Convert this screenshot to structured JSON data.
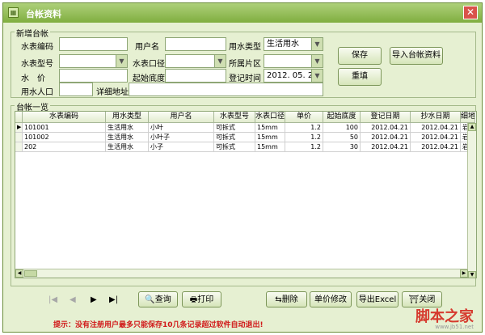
{
  "window": {
    "title": "台帐资料",
    "close_label": "✕"
  },
  "form": {
    "group_label": "新增台帐",
    "meter_no_label": "水表编码",
    "meter_no_value": "",
    "user_name_label": "用户名",
    "user_name_value": "",
    "water_type_label": "用水类型",
    "water_type_value": "生活用水",
    "meter_model_label": "水表型号",
    "meter_model_value": "",
    "caliber_label": "水表口径",
    "caliber_value": "",
    "area_label": "所属片区",
    "area_value": "",
    "price_label": "水　价",
    "price_value": "",
    "start_reading_label": "起始底度",
    "start_reading_value": "",
    "reg_time_label": "登记时间",
    "reg_time_value": "2012. 05. 22",
    "population_label": "用水人口",
    "population_value": "",
    "address_label": "详细地址",
    "address_value": "",
    "save_label": "保存",
    "import_label": "导入台帐资料",
    "clear_label": "重填"
  },
  "table": {
    "group_label": "台帐一览",
    "columns": [
      "水表编码",
      "用水类型",
      "用户名",
      "水表型号",
      "水表口径",
      "单价",
      "起始底度",
      "登记日期",
      "抄水日期",
      "细地"
    ],
    "rows": [
      [
        "101001",
        "生活用水",
        "小叶",
        "可拆式",
        "15mm",
        "1.2",
        "100",
        "2012.04.21",
        "2012.04.21",
        "岩溪"
      ],
      [
        "101002",
        "生活用水",
        "小叶子",
        "可拆式",
        "15mm",
        "1.2",
        "50",
        "2012.04.21",
        "2012.04.21",
        "岩溪"
      ],
      [
        "202",
        "生活用水",
        "小子",
        "可拆式",
        "15mm",
        "1.2",
        "30",
        "2012.04.21",
        "2012.04.21",
        "岩溪"
      ]
    ]
  },
  "toolbar": {
    "first": "|◀",
    "prev": "◀",
    "next": "▶",
    "last": "▶|",
    "query_label": "查询",
    "print_label": "打印",
    "delete_label": "删除",
    "edit_price_label": "单价修改",
    "export_label": "导出Excel",
    "close_label": "关闭"
  },
  "hint": "提示：没有注册用户最多只能保存10几条记录超过软件自动退出!",
  "watermark": {
    "main": "脚本之家",
    "sub": "www.jb51.net"
  }
}
